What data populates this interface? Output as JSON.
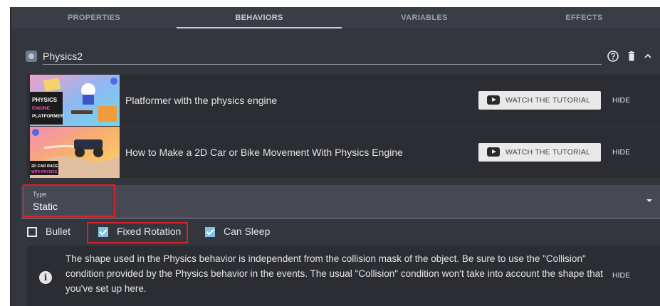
{
  "tabs": [
    {
      "label": "PROPERTIES"
    },
    {
      "label": "BEHAVIORS"
    },
    {
      "label": "VARIABLES"
    },
    {
      "label": "EFFECTS"
    }
  ],
  "active_tab": "BEHAVIORS",
  "behavior": {
    "name": "Physics2",
    "icons": [
      "help-icon",
      "trash-icon",
      "collapse-icon"
    ]
  },
  "tutorials": [
    {
      "thumbnail_text": [
        "PHYSICS",
        "ENGINE",
        "PLATFORMER"
      ],
      "title": "Platformer with the physics engine",
      "watch_label": "WATCH THE TUTORIAL",
      "hide_label": "HIDE"
    },
    {
      "thumbnail_text": [
        "2D CAR RACE",
        "WITH PHYSICS"
      ],
      "title": "How to Make a 2D Car or Bike Movement With Physics Engine",
      "watch_label": "WATCH THE TUTORIAL",
      "hide_label": "HIDE"
    }
  ],
  "type_select": {
    "label": "Type",
    "value": "Static"
  },
  "checkboxes": [
    {
      "label": "Bullet",
      "checked": false
    },
    {
      "label": "Fixed Rotation",
      "checked": true
    },
    {
      "label": "Can Sleep",
      "checked": true
    }
  ],
  "info": {
    "text": "The shape used in the Physics behavior is independent from the collision mask of the object. Be sure to use the \"Collision\" condition provided by the Physics behavior in the events. The usual \"Collision\" condition won't take into account the shape that you've set up here.",
    "hide_label": "HIDE"
  },
  "colors": {
    "panel": "#34363d",
    "card": "#2b2d33",
    "checkbox_on": "#7ec3e6",
    "highlight": "#d9232a"
  }
}
